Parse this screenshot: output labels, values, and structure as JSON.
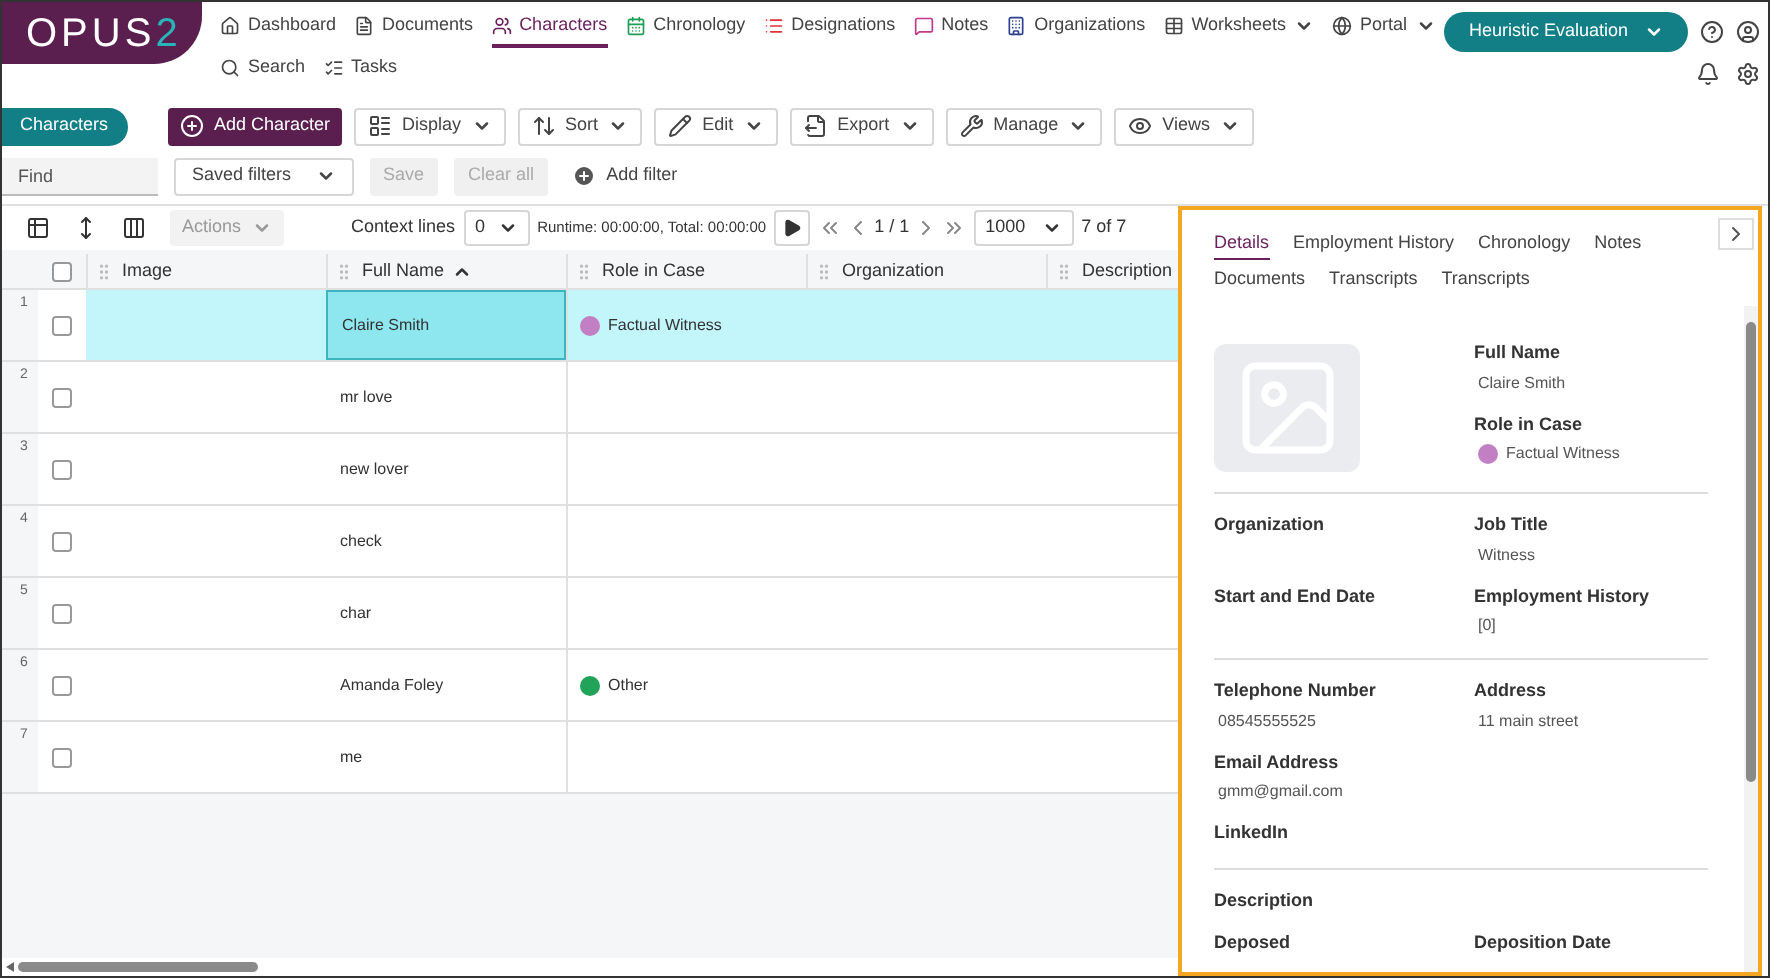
{
  "logo": {
    "text": "OPUS",
    "accent": "2"
  },
  "nav": [
    {
      "label": "Dashboard",
      "selected": false,
      "has_menu": false
    },
    {
      "label": "Documents",
      "selected": false,
      "has_menu": false
    },
    {
      "label": "Characters",
      "selected": true,
      "has_menu": false
    },
    {
      "label": "Chronology",
      "selected": false,
      "has_menu": false
    },
    {
      "label": "Designations",
      "selected": false,
      "has_menu": false
    },
    {
      "label": "Notes",
      "selected": false,
      "has_menu": false
    },
    {
      "label": "Organizations",
      "selected": false,
      "has_menu": false
    },
    {
      "label": "Worksheets",
      "selected": false,
      "has_menu": true
    },
    {
      "label": "Portal",
      "selected": false,
      "has_menu": true
    },
    {
      "label": "Search",
      "selected": false,
      "has_menu": false
    },
    {
      "label": "Tasks",
      "selected": false,
      "has_menu": false
    }
  ],
  "project_button": "Heuristic Evaluation",
  "module_tab": "Characters",
  "toolbar": [
    {
      "label": "Add Character",
      "kind": "primary"
    },
    {
      "label": "Display",
      "kind": "menu"
    },
    {
      "label": "Sort",
      "kind": "menu"
    },
    {
      "label": "Edit",
      "kind": "menu"
    },
    {
      "label": "Export",
      "kind": "menu"
    },
    {
      "label": "Manage",
      "kind": "menu"
    },
    {
      "label": "Views",
      "kind": "menu"
    }
  ],
  "filters": {
    "find_placeholder": "Find",
    "saved_filters": "Saved filters",
    "save": {
      "label": "Save",
      "disabled": true
    },
    "clear_all": {
      "label": "Clear all",
      "disabled": true
    },
    "add_filter": "Add filter"
  },
  "grid_toolbar": {
    "actions": {
      "label": "Actions",
      "disabled": true
    },
    "context_lines_label": "Context lines",
    "context_lines": "0",
    "runtime": "Runtime: 00:00:00, Total: 00:00:00",
    "pager": "1 / 1",
    "page_size": "1000",
    "count": "7 of 7"
  },
  "select_all_checked": false,
  "columns": [
    {
      "label": "Image",
      "sorted": false
    },
    {
      "label": "Full Name",
      "sorted": true
    },
    {
      "label": "Role in Case",
      "sorted": false
    },
    {
      "label": "Organization",
      "sorted": false
    },
    {
      "label": "Description",
      "sorted": false
    }
  ],
  "rows": [
    {
      "number": "1",
      "full_name": "Claire Smith",
      "role": {
        "label": "Factual Witness",
        "color": "#c27fc4"
      },
      "selected": true
    },
    {
      "number": "2",
      "full_name": "mr love",
      "selected": false
    },
    {
      "number": "3",
      "full_name": "new lover",
      "selected": false
    },
    {
      "number": "4",
      "full_name": "check",
      "selected": false
    },
    {
      "number": "5",
      "full_name": "char",
      "selected": false
    },
    {
      "number": "6",
      "full_name": "Amanda Foley",
      "role": {
        "label": "Other",
        "color": "#21a35a"
      },
      "selected": false
    },
    {
      "number": "7",
      "full_name": "me",
      "selected": false
    }
  ],
  "details": {
    "tabs": [
      {
        "label": "Details",
        "selected": true
      },
      {
        "label": "Employment History",
        "selected": false
      },
      {
        "label": "Chronology",
        "selected": false
      },
      {
        "label": "Notes",
        "selected": false
      },
      {
        "label": "Documents",
        "selected": false
      },
      {
        "label": "Transcripts",
        "selected": false
      },
      {
        "label": "Transcripts",
        "selected": false
      }
    ],
    "sections": [
      {
        "kind": "profile",
        "rows": [
          [
            {
              "label": "Full Name",
              "value": "Claire Smith"
            }
          ],
          [
            {
              "label": "Role in Case",
              "value": "Factual Witness",
              "color": "#c27fc4"
            }
          ]
        ]
      },
      {
        "kind": "fields",
        "rows": [
          [
            {
              "label": "Organization"
            },
            {
              "label": "Job Title",
              "value": "Witness"
            }
          ],
          [
            {
              "label": "Start and End Date"
            },
            {
              "label": "Employment History",
              "value": "[0]"
            }
          ]
        ]
      },
      {
        "kind": "fields",
        "rows": [
          [
            {
              "label": "Telephone Number",
              "value": "08545555525"
            },
            {
              "label": "Address",
              "value": "11 main street"
            }
          ],
          [
            {
              "label": "Email Address",
              "value": "gmm@gmail.com"
            }
          ],
          [
            {
              "label": "LinkedIn"
            }
          ]
        ]
      },
      {
        "kind": "fields",
        "rows": [
          [
            {
              "label": "Description"
            }
          ],
          [
            {
              "label": "Deposed"
            },
            {
              "label": "Deposition Date"
            }
          ]
        ]
      }
    ]
  }
}
